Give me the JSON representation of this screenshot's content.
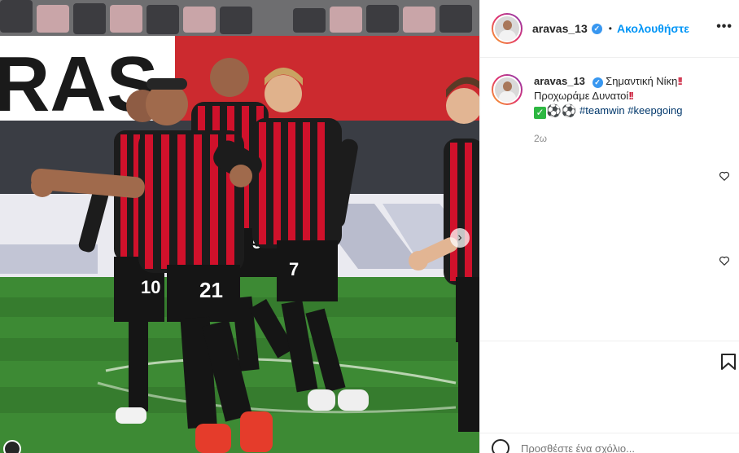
{
  "post": {
    "username": "aravas_13",
    "follow_label": "Ακολουθήστε",
    "separator": "•",
    "more_label": "•••",
    "caption_line1": "Σημαντική Νίκη",
    "caption_line2": "Προχωράμε Δυνατοί",
    "hashtag1": "#teamwin",
    "hashtag2": "#keepgoing",
    "time_ago": "2ω",
    "comment_placeholder": "Προσθέστε ένα σχόλιο..."
  },
  "photo": {
    "banner_text": "RAS",
    "jersey_numbers": [
      "10",
      "21",
      "5",
      "7"
    ]
  },
  "colors": {
    "accent": "#0095f6",
    "verified": "#3897f0",
    "hashtag": "#00376b",
    "jersey_red": "#d0112b"
  },
  "icons": [
    "verified-icon",
    "more-icon",
    "heart-icon",
    "bookmark-icon",
    "emoji-icon",
    "chevron-right-icon"
  ]
}
